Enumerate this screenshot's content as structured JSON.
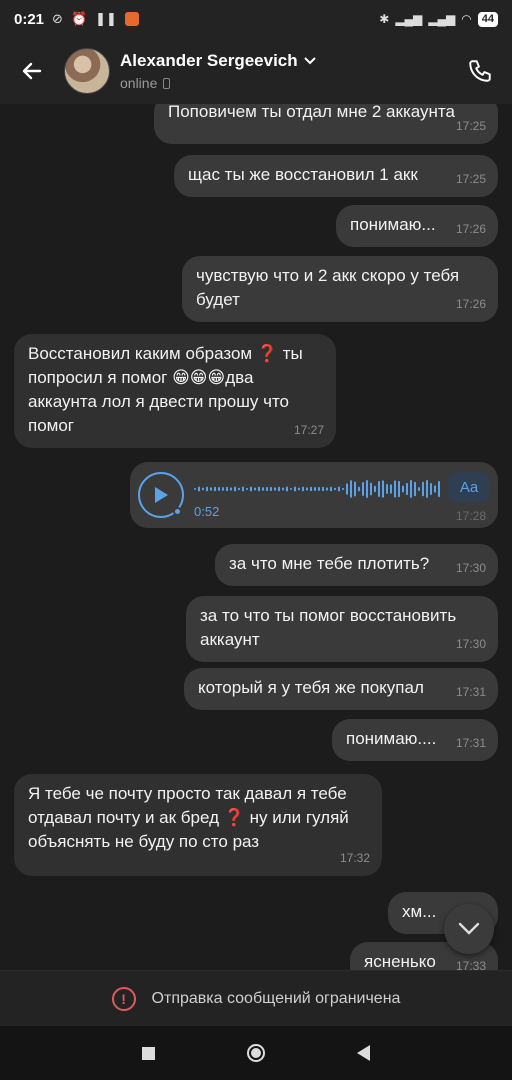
{
  "status_bar": {
    "time": "0:21",
    "battery": "44"
  },
  "header": {
    "contact_name": "Alexander Sergeevich",
    "contact_status": "online"
  },
  "messages": [
    {
      "text": "Поповичем ты отдал мне 2 аккаунта",
      "time": "17:25",
      "dir": "out"
    },
    {
      "text": "щас ты же восстановил 1 акк",
      "time": "17:25",
      "dir": "out"
    },
    {
      "text": "понимаю...",
      "time": "17:26",
      "dir": "out"
    },
    {
      "text": "чувствую что и 2 акк скоро у тебя будет",
      "time": "17:26",
      "dir": "out"
    },
    {
      "text": "Восстановил каким образом ❓ ты попросил я помог 😁😁😁два аккаунта лол я двести прошу что помог",
      "time": "17:27",
      "dir": "in"
    },
    {
      "text": "за что мне тебе плотить?",
      "time": "17:30",
      "dir": "out"
    },
    {
      "text": "за то что ты помог восстановить аккаунт",
      "time": "17:30",
      "dir": "out"
    },
    {
      "text": "который я у тебя же покупал",
      "time": "17:31",
      "dir": "out"
    },
    {
      "text": "понимаю....",
      "time": "17:31",
      "dir": "out"
    },
    {
      "text": "Я тебе че почту просто так давал я тебе отдавал почту и ак бред ❓ ну или гуляй объяснять не буду по сто раз",
      "time": "17:32",
      "dir": "in"
    },
    {
      "text": "хм...",
      "time": "",
      "dir": "out"
    },
    {
      "text": "ясненько",
      "time": "17:33",
      "dir": "out"
    }
  ],
  "voice_message": {
    "duration": "0:52",
    "transcribe_label": "Aa",
    "time": "17:28"
  },
  "footer": {
    "restriction_text": "Отправка сообщений ограничена"
  },
  "colors": {
    "accent": "#5aa2e8",
    "warning": "#e05a5a",
    "bubble_out": "#3a3a3a",
    "bubble_in": "#303030"
  }
}
